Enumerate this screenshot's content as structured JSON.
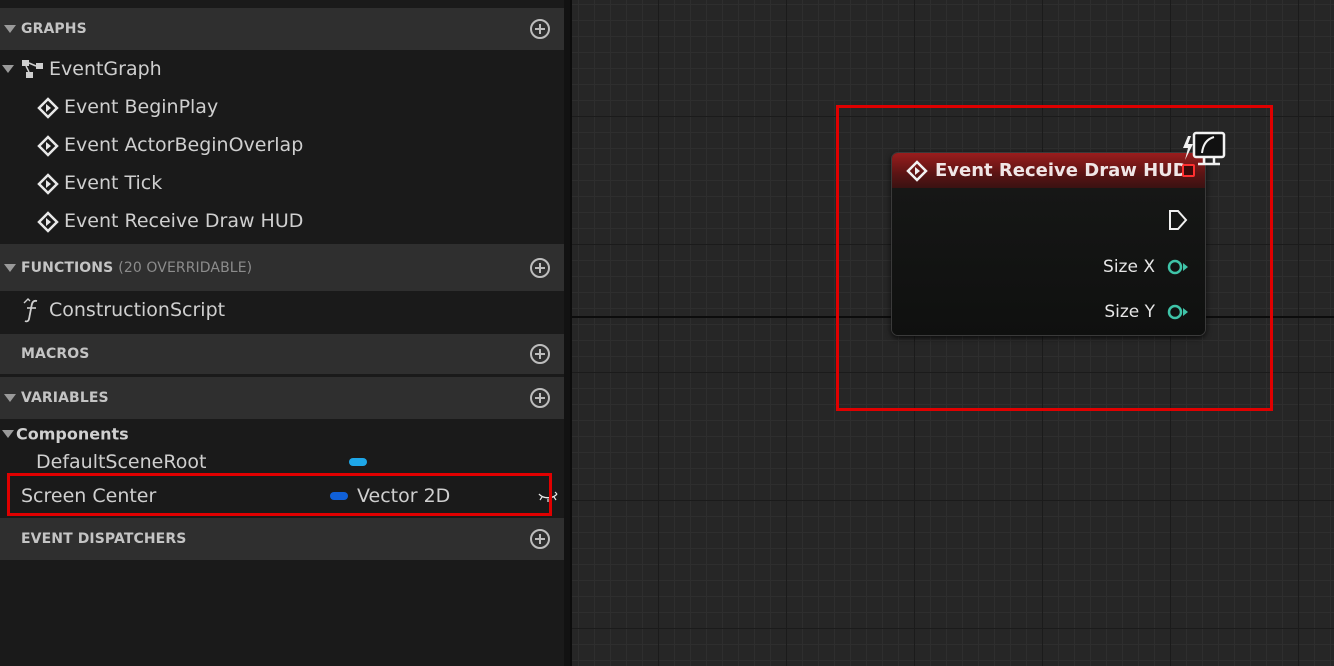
{
  "sections": {
    "graphs": {
      "title": "GRAPHS"
    },
    "functions": {
      "title": "FUNCTIONS",
      "subtitle": "(20 OVERRIDABLE)"
    },
    "macros": {
      "title": "MACROS"
    },
    "variables": {
      "title": "VARIABLES"
    },
    "event_dispatchers": {
      "title": "EVENT DISPATCHERS"
    }
  },
  "graphs": {
    "event_graph": "EventGraph",
    "events": [
      "Event BeginPlay",
      "Event ActorBeginOverlap",
      "Event Tick",
      "Event Receive Draw HUD"
    ]
  },
  "functions": {
    "items": [
      "ConstructionScript"
    ]
  },
  "variables": {
    "category": "Components",
    "items": [
      {
        "name": "DefaultSceneRoot",
        "type": "",
        "color": "#1ea7e8"
      },
      {
        "name": "Screen Center",
        "type": "Vector 2D",
        "color": "#1060d8"
      }
    ]
  },
  "node": {
    "title": "Event Receive Draw HUD",
    "header_color": "#9a1d1d",
    "pins": [
      "Size X",
      "Size Y"
    ],
    "pin_color": "#3fc4a8"
  },
  "colors": {
    "highlight": "#e00000"
  },
  "icons": {
    "add": "plus-circle-icon",
    "event": "event-diamond-icon",
    "graph": "graph-icon",
    "function": "function-icon",
    "hud": "monitor-lightning-icon",
    "eye": "eye-closed-icon"
  }
}
